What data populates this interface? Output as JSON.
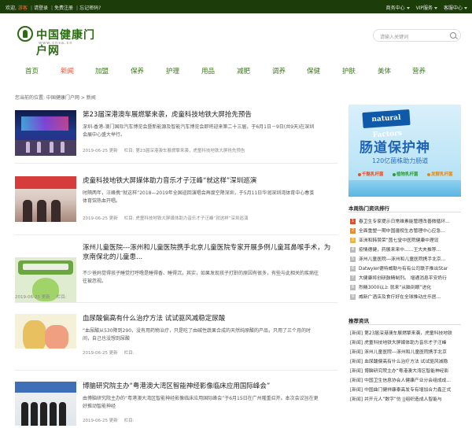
{
  "topbar": {
    "welcome": "欢迎,",
    "highlight": "游客",
    "sep1": "|",
    "login": "请登录",
    "sep2": "|",
    "register": "免费注册",
    "sep3": "|",
    "forgot": "忘记密码?",
    "right_items": [
      "商务中心",
      "VIP服务",
      "客服中心"
    ]
  },
  "logo": {
    "title": "中国健康门户网",
    "sub": "www.cnsa.cn"
  },
  "search": {
    "placeholder": "请输入关键词"
  },
  "nav": [
    "首页",
    "新闻",
    "加盟",
    "保养",
    "护理",
    "用品",
    "减肥",
    "调养",
    "保健",
    "护肤",
    "美体",
    "营养"
  ],
  "breadcrumb": "您当前的位置: 中国健康门户网 > 新闻",
  "articles": [
    {
      "title": "第23届深港澳车展燃擎来袭，虎童科技地铁大屏抢先预告",
      "summary": "深圳-香港-澳门国际汽车博览会暨新能源及智能汽车博览会即将迎来第二十三届，于6月1日－9日(共9天)在深圳会展中心盛大举行。",
      "date": "2019-06-25",
      "label": "更新",
      "tag": "栏目:",
      "tag_text": "第23届深港澳车展燃擎来袭，虎童科技地铁大屏抢先预告"
    },
    {
      "title": "虎童科技地铁大屏媒体助力音乐才子汪峰“就这样”深圳巡演",
      "summary": "时隔两年，汪峰携“就这样”2018—2019年全国巡回演唱会再度空降深圳，于5月11日华润深圳湾体育中心春茧体育馆热血开唱。",
      "date": "2019-06-25",
      "label": "更新",
      "tag": "栏目:",
      "tag_text": "虎童科技地铁大屏媒体助力音乐才子汪峰“就这样”深圳巡演"
    },
    {
      "title": "涿州儿童医院---涿州和儿童医院携手北京儿童医院专家开展多例儿童耳鼻喉手术，为京南保北的儿童患...",
      "summary": "不少爸妈觉得孩子睡觉打呼噜是睡得香、睡得沉，其实，如果发现孩子打鼾的原因有很多，有些与此相关的疾病往往被忽视。",
      "date": "2019-06-25",
      "label": "更新",
      "tag": "栏目:",
      "tag_text": ""
    },
    {
      "title": "血尿酸偏高有什么治疗方法 试试驱风减稳定尿酸",
      "summary": "“血尿酸从530降到290，没有用药物治疗，只是吃了由碱性蔬果合成的天然纯原酸的产品，只用了三个月的时间，自己也没想到尿酸",
      "date": "2019-06-25",
      "label": "更新",
      "tag": "栏目:",
      "tag_text": ""
    },
    {
      "title": "博脑研究院主办“粤港澳大湾区智能神经影像临床应用国际峰会”",
      "summary": "由博脑研究院主办的“粤港澳大湾区智能神经影像临床应用国际峰会”于6月15日在广州隆重召开。本次会议旨在更好推动智能神经",
      "date": "2019-06-25",
      "label": "更新",
      "tag": "栏目:",
      "tag_text": ""
    }
  ],
  "ad": {
    "brand": "natural Factors",
    "headline": "肠道保护神",
    "sub": "120亿菌株助力肠道",
    "features": [
      "千酪乳杆菌",
      "植物乳杆菌",
      "发酵乳杆菌"
    ],
    "colors": {
      "brand_bg": "#0f5aa8",
      "headline": "#1f63b5",
      "feature_1": "#e2502b",
      "feature_2": "#2d9a3a",
      "feature_3": "#e08a1a"
    }
  },
  "sidebar": {
    "hot_title": "本周热门资讯排行",
    "hot_list": [
      "春卫生专家提示日常维素能管理改善微循环...",
      "全面重塑一期中国疆视生态管理中心应急...",
      "亚洲和韩赞荣“茵七堂中医院健康中理设",
      "疫情德健，药展来来中……王大夫推荐...",
      "涿州儿童医院---涿州和儿童医院携手北京...",
      "Datwyler德特威勒与有有公司联手推出Star",
      "大健康将创研鼓精制剂。 增通消息平安奶行",
      "烈精3000以上 就来“从脑到眼”进化",
      "威新广酒店及食疗好在全球推动庄乐居..."
    ],
    "rec_title": "推荐资讯",
    "rec_label": "[新闻]",
    "rec_list": [
      "第23届深港澳车展燃擎来袭，虎童科技地铁",
      "虎童科技地铁大屏媒体助力音乐才子汪峰",
      "涿州儿童医院---涿州和儿童医院携手北京",
      "血尿酸偏高有什么治疗方法 试试驱风减稳",
      "博脑研究院主办“粤港澳大湾区智能神经影",
      "中国卫生信息协会人健康产业分会组成成...",
      "中国曲门健祥康泰高发专有增加合力鑫正式",
      "并开元人“数字”仿 ||组织造成人智能与"
    ]
  }
}
